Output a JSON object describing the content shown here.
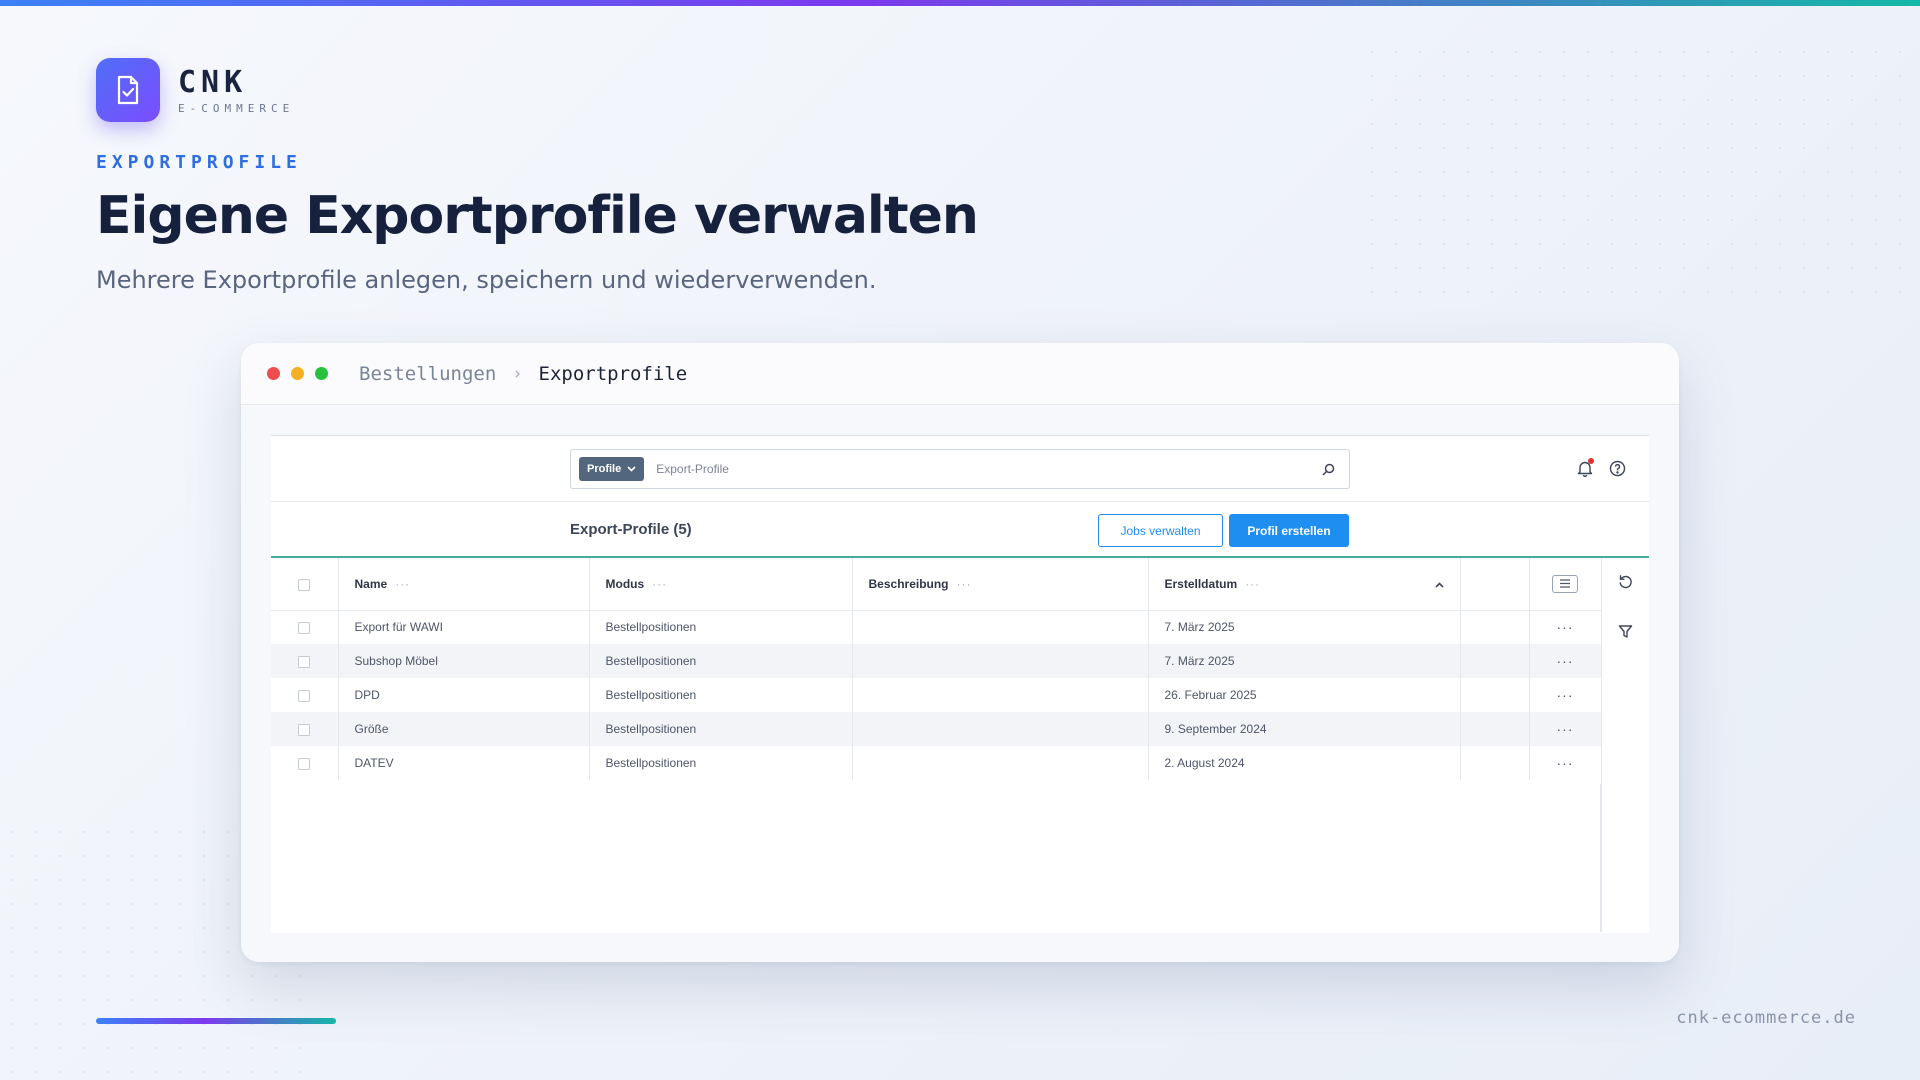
{
  "brand": {
    "name": "CNK",
    "tagline": "E-COMMERCE",
    "icon": "document-check-icon"
  },
  "hero": {
    "eyebrow": "EXPORTPROFILE",
    "title": "Eigene Exportprofile verwalten",
    "subtitle": "Mehrere Exportprofile anlegen, speichern und wiederverwenden."
  },
  "window": {
    "breadcrumb": {
      "parent": "Bestellungen",
      "current": "Exportprofile"
    }
  },
  "app": {
    "search": {
      "scope": "Profile",
      "placeholder": "Export-Profile"
    },
    "list_title": "Export-Profile (5)",
    "actions": {
      "manage_jobs": "Jobs verwalten",
      "create_profile": "Profil erstellen"
    },
    "columns": {
      "name": "Name",
      "mode": "Modus",
      "description": "Beschreibung",
      "created": "Erstelldatum"
    },
    "rows": [
      {
        "name": "Export für WAWI",
        "mode": "Bestellpositionen",
        "description": "",
        "created": "7. März 2025"
      },
      {
        "name": "Subshop Möbel",
        "mode": "Bestellpositionen",
        "description": "",
        "created": "7. März 2025"
      },
      {
        "name": "DPD",
        "mode": "Bestellpositionen",
        "description": "",
        "created": "26. Februar 2025"
      },
      {
        "name": "Größe",
        "mode": "Bestellpositionen",
        "description": "",
        "created": "9. September 2024"
      },
      {
        "name": "DATEV",
        "mode": "Bestellpositionen",
        "description": "",
        "created": "2. August 2024"
      }
    ]
  },
  "footer": {
    "url": "cnk-ecommerce.de"
  },
  "colors": {
    "accent": "#1f8ef1",
    "brand_gradient_start": "#4f6ef7",
    "brand_gradient_end": "#7c4dff",
    "table_divider": "#46a9a0"
  }
}
